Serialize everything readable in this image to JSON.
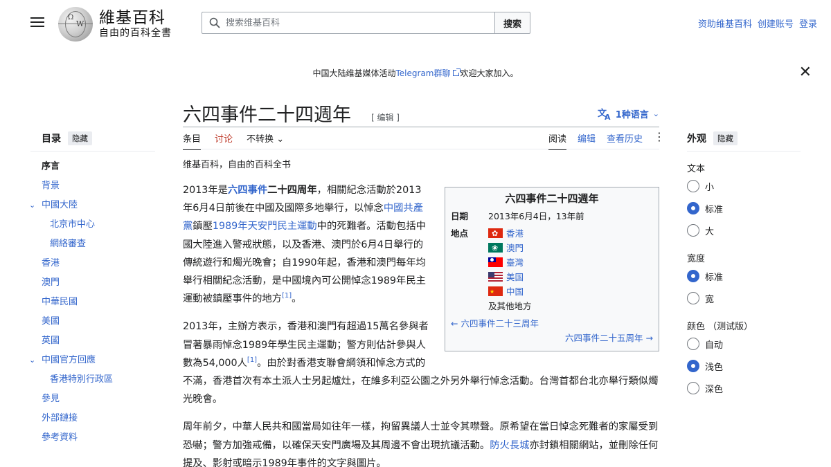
{
  "header": {
    "logo_name": "維基百科",
    "logo_tagline": "自由的百科全書",
    "search_placeholder": "搜索维基百科",
    "search_button": "搜索",
    "user_links": [
      "资助维基百科",
      "创建账号",
      "登录"
    ]
  },
  "banner": {
    "prefix": "中国大陆维基媒体活动",
    "link": "Telegram群聊",
    "suffix": "欢迎大家加入。"
  },
  "page": {
    "title": "六四事件二十四週年",
    "edit": "[ 编辑 ]",
    "languages": "1种语言"
  },
  "tabs": {
    "article": "条目",
    "talk": "讨论",
    "variant": "不转换",
    "read": "阅读",
    "edit": "编辑",
    "history": "查看历史"
  },
  "tagline": "维基百科，自由的百科全书",
  "toc": {
    "title": "目录",
    "hide": "隐藏",
    "items": [
      {
        "label": "序言",
        "level": 1
      },
      {
        "label": "背景",
        "level": 1
      },
      {
        "label": "中國大陸",
        "level": 1
      },
      {
        "label": "北京市中心",
        "level": 2
      },
      {
        "label": "網絡審查",
        "level": 2
      },
      {
        "label": "香港",
        "level": 1
      },
      {
        "label": "澳門",
        "level": 1
      },
      {
        "label": "中華民國",
        "level": 1
      },
      {
        "label": "美國",
        "level": 1
      },
      {
        "label": "英國",
        "level": 1
      },
      {
        "label": "中國官方回應",
        "level": 1
      },
      {
        "label": "香港特別行政區",
        "level": 2
      },
      {
        "label": "參見",
        "level": 1
      },
      {
        "label": "外部鏈接",
        "level": 1
      },
      {
        "label": "參考資料",
        "level": 1
      }
    ]
  },
  "appearance": {
    "title": "外观",
    "hide": "隐藏",
    "text_label": "文本",
    "text_options": [
      "小",
      "标准",
      "大"
    ],
    "text_selected": "标准",
    "width_label": "宽度",
    "width_options": [
      "标准",
      "宽"
    ],
    "width_selected": "标准",
    "color_label": "颜色 （测试版）",
    "color_options": [
      "自动",
      "浅色",
      "深色"
    ],
    "color_selected": "浅色"
  },
  "infobox": {
    "title": "六四事件二十四週年",
    "date_label": "日期",
    "date_value": "2013年6月4日，13年前",
    "location_label": "地点",
    "locations": [
      "香港",
      "澳門",
      "臺灣",
      "美国",
      "中国"
    ],
    "other_locations": "及其他地方",
    "prev": "← 六四事件二十三周年",
    "next": "六四事件二十五周年 →"
  },
  "article": {
    "p1": {
      "t1": "2013年是",
      "l1": "六四事件",
      "t2": "二十四周年",
      "t3": "，相關紀念活動於2013年6月4日前後在中國及國際多地舉行，以悼念",
      "l2": "中國共產黨",
      "t4": "鎮壓",
      "l3": "1989年天安門民主運動",
      "t5": "中的死難者。活動包括中國大陸進入警戒狀態，以及香港、澳門於6月4日舉行的傳統遊行和燭光晚會；自1990年起，香港和澳門每年均舉行相關紀念活動，是中國境內可公開悼念1989年民主運動被鎮壓事件的地方",
      "ref": "[1]",
      "t6": "。"
    },
    "p2": {
      "t1": "2013年，主辦方表示，香港和澳門有超過15萬名參與者冒著暴雨悼念1989年學生民主運動；警方則估計參與人數為54,000人",
      "ref": "[1]",
      "t2": "。由於對香港支聯會綱領和悼念方式的不滿，香港首次有本土派人士另起爐灶，在維多利亞公園之外另外舉行悼念活動。台灣首都台北亦舉行類似燭光晚會。"
    },
    "p3": {
      "t1": "周年前夕，中華人民共和國當局如往年一樣，拘留異議人士並令其噤聲。原希望在當日悼念死難者的家屬受到恐嚇；警方加強戒備，以確保天安門廣場及其周邊不會出現抗議活動。",
      "l1": "防火長城",
      "t2": "亦封鎖相關網站，並刪除任何提及、影射或暗示1989年事件的文字與圖片。"
    }
  }
}
